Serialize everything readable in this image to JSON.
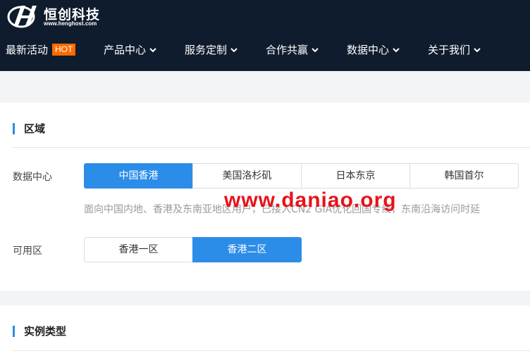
{
  "header": {
    "brand_name": "恒创科技",
    "brand_url": "www.henghost.com",
    "nav": [
      {
        "label": "最新活动",
        "badge": "HOT"
      },
      {
        "label": "产品中心"
      },
      {
        "label": "服务定制"
      },
      {
        "label": "合作共赢"
      },
      {
        "label": "数据中心"
      },
      {
        "label": "关于我们"
      }
    ]
  },
  "region": {
    "title": "区域",
    "datacenter_label": "数据中心",
    "datacenters": [
      "中国香港",
      "美国洛杉矶",
      "日本东京",
      "韩国首尔"
    ],
    "datacenter_selected": "中国香港",
    "description": "面向中国内地、香港及东南亚地区用户，已接入CN2 GIA优化回国专线，东南沿海访问时延",
    "zone_label": "可用区",
    "zones": [
      "香港一区",
      "香港二区"
    ],
    "zone_selected": "香港二区"
  },
  "instance": {
    "title": "实例类型"
  },
  "watermark": "www.daniao.org",
  "colors": {
    "header_bg": "#0f1c2e",
    "accent": "#2b8de8",
    "hot_badge": "#ff6a00",
    "watermark": "#e8131b"
  }
}
